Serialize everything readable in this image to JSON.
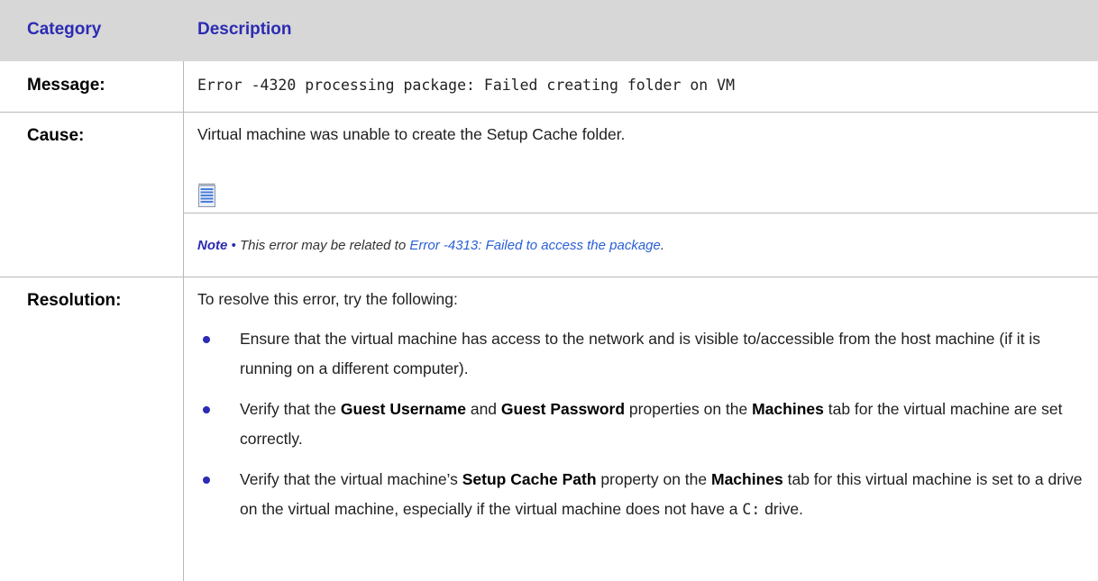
{
  "table": {
    "headers": {
      "category": "Category",
      "description": "Description"
    },
    "message": {
      "label": "Message:",
      "value": "Error -4320 processing package: Failed creating folder on VM"
    },
    "cause": {
      "label": "Cause:",
      "text": "Virtual machine was unable to create the Setup Cache folder.",
      "note": {
        "icon": "notepad-icon",
        "label": "Note",
        "separator": "•",
        "text": "This error may be related to",
        "link": "Error -4313: Failed to access the package",
        "end": "."
      }
    },
    "resolution": {
      "label": "Resolution:",
      "intro": "To resolve this error, try the following:",
      "bullet_color": "#2b2bb3",
      "items": [
        {
          "parts": [
            "Ensure that the virtual machine has access to the network and is visible to/accessible from the host machine (if it is running on a different computer)."
          ]
        },
        {
          "parts": [
            "Verify that the ",
            "Guest Username",
            " and ",
            "Guest Password",
            " properties on the ",
            "Machines",
            " tab for the virtual machine are set correctly."
          ]
        },
        {
          "parts": [
            "Verify that the virtual machine’s ",
            "Setup Cache Path",
            " property on the ",
            "Machines",
            " tab for this virtual machine is set to a drive on the virtual machine, especially if the virtual machine does not have a ",
            "C:",
            " drive."
          ]
        }
      ]
    }
  },
  "colors": {
    "header_bg": "#d7d7d7",
    "header_text": "#2b2bb3",
    "link": "#2a5fd6",
    "grid": "#b9b9b9"
  }
}
